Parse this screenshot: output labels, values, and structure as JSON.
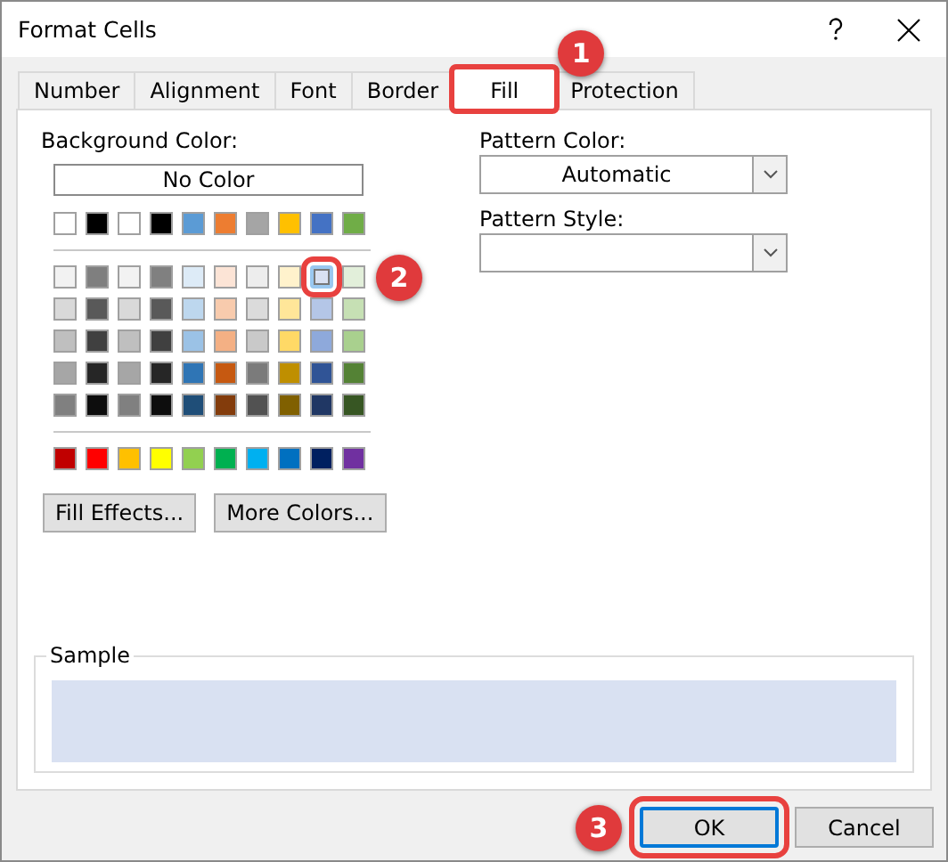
{
  "window": {
    "title": "Format Cells"
  },
  "tabs": [
    {
      "label": "Number",
      "selected": false
    },
    {
      "label": "Alignment",
      "selected": false
    },
    {
      "label": "Font",
      "selected": false
    },
    {
      "label": "Border",
      "selected": false
    },
    {
      "label": "Fill",
      "selected": true,
      "callout": "1"
    },
    {
      "label": "Protection",
      "selected": false
    }
  ],
  "background_color": {
    "label": "Background Color:",
    "no_color_button": "No Color",
    "theme_colors": [
      {
        "color": "#ffffff",
        "selected": false
      },
      {
        "color": "#000000",
        "selected": false
      },
      {
        "color": "#ffffff",
        "selected": false
      },
      {
        "color": "#000000",
        "selected": false
      },
      {
        "color": "#5b9bd5",
        "selected": false
      },
      {
        "color": "#ed7d31",
        "selected": false
      },
      {
        "color": "#a5a5a5",
        "selected": false
      },
      {
        "color": "#ffc000",
        "selected": false
      },
      {
        "color": "#4472c4",
        "selected": false
      },
      {
        "color": "#70ad47",
        "selected": false
      }
    ],
    "shades": [
      [
        {
          "color": "#f2f2f2",
          "selected": false
        },
        {
          "color": "#7f7f7f",
          "selected": false
        },
        {
          "color": "#f2f2f2",
          "selected": false
        },
        {
          "color": "#808080",
          "selected": false
        },
        {
          "color": "#ddebf7",
          "selected": false
        },
        {
          "color": "#fce4d6",
          "selected": false
        },
        {
          "color": "#ededed",
          "selected": false
        },
        {
          "color": "#fff2cc",
          "selected": false
        },
        {
          "color": "#d9e1f2",
          "selected": true,
          "callout": "2"
        },
        {
          "color": "#e2efda",
          "selected": false
        }
      ],
      [
        {
          "color": "#d9d9d9",
          "selected": false
        },
        {
          "color": "#595959",
          "selected": false
        },
        {
          "color": "#d9d9d9",
          "selected": false
        },
        {
          "color": "#595959",
          "selected": false
        },
        {
          "color": "#bdd7ee",
          "selected": false
        },
        {
          "color": "#f8cbad",
          "selected": false
        },
        {
          "color": "#dbdbdb",
          "selected": false
        },
        {
          "color": "#ffe699",
          "selected": false
        },
        {
          "color": "#b4c6e7",
          "selected": false
        },
        {
          "color": "#c6e0b4",
          "selected": false
        }
      ],
      [
        {
          "color": "#bfbfbf",
          "selected": false
        },
        {
          "color": "#404040",
          "selected": false
        },
        {
          "color": "#bfbfbf",
          "selected": false
        },
        {
          "color": "#404040",
          "selected": false
        },
        {
          "color": "#9bc2e6",
          "selected": false
        },
        {
          "color": "#f4b084",
          "selected": false
        },
        {
          "color": "#c9c9c9",
          "selected": false
        },
        {
          "color": "#ffd966",
          "selected": false
        },
        {
          "color": "#8ea9db",
          "selected": false
        },
        {
          "color": "#a9d08e",
          "selected": false
        }
      ],
      [
        {
          "color": "#a6a6a6",
          "selected": false
        },
        {
          "color": "#262626",
          "selected": false
        },
        {
          "color": "#a6a6a6",
          "selected": false
        },
        {
          "color": "#262626",
          "selected": false
        },
        {
          "color": "#2f75b5",
          "selected": false
        },
        {
          "color": "#c65911",
          "selected": false
        },
        {
          "color": "#7b7b7b",
          "selected": false
        },
        {
          "color": "#bf8f00",
          "selected": false
        },
        {
          "color": "#305496",
          "selected": false
        },
        {
          "color": "#548235",
          "selected": false
        }
      ],
      [
        {
          "color": "#808080",
          "selected": false
        },
        {
          "color": "#0d0d0d",
          "selected": false
        },
        {
          "color": "#808080",
          "selected": false
        },
        {
          "color": "#0d0d0d",
          "selected": false
        },
        {
          "color": "#1f4e78",
          "selected": false
        },
        {
          "color": "#833c0c",
          "selected": false
        },
        {
          "color": "#525252",
          "selected": false
        },
        {
          "color": "#806000",
          "selected": false
        },
        {
          "color": "#203764",
          "selected": false
        },
        {
          "color": "#375623",
          "selected": false
        }
      ]
    ],
    "standard_colors": [
      {
        "color": "#c00000",
        "selected": false
      },
      {
        "color": "#ff0000",
        "selected": false
      },
      {
        "color": "#ffc000",
        "selected": false
      },
      {
        "color": "#ffff00",
        "selected": false
      },
      {
        "color": "#92d050",
        "selected": false
      },
      {
        "color": "#00b050",
        "selected": false
      },
      {
        "color": "#00b0f0",
        "selected": false
      },
      {
        "color": "#0070c0",
        "selected": false
      },
      {
        "color": "#002060",
        "selected": false
      },
      {
        "color": "#7030a0",
        "selected": false
      }
    ],
    "buttons": [
      "Fill Effects...",
      "More Colors..."
    ]
  },
  "pattern_color": {
    "label": "Pattern Color:",
    "value": "Automatic"
  },
  "pattern_style": {
    "label": "Pattern Style:"
  },
  "sample": {
    "label": "Sample",
    "color": "#d9e1f2"
  },
  "buttons": [
    {
      "label": "OK",
      "default": true,
      "callout": "3"
    },
    {
      "label": "Cancel",
      "default": false
    }
  ]
}
